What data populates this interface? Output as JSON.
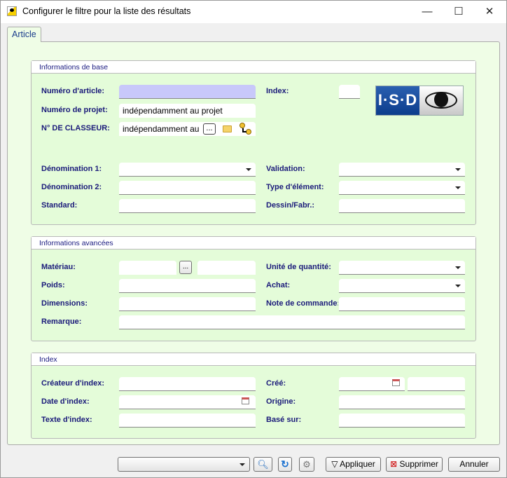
{
  "window": {
    "title": "Configurer le filtre pour la liste des résultats",
    "minimize": "—",
    "maximize": "☐",
    "close": "✕"
  },
  "tab": "Article",
  "groups": {
    "base": {
      "title": "Informations de base",
      "article_label": "Numéro d'article:",
      "project_label": "Numéro de projet:",
      "project_value": "indépendamment au projet",
      "folder_label": "N° DE CLASSEUR:",
      "folder_value": "indépendamment au",
      "browse": "...",
      "index_label": "Index:",
      "logo": "I·S·D",
      "den1_label": "Dénomination 1:",
      "den2_label": "Dénomination 2:",
      "standard_label": "Standard:",
      "validation_label": "Validation:",
      "type_label": "Type d'élément:",
      "drawing_label": "Dessin/Fabr.:"
    },
    "advanced": {
      "title": "Informations avancées",
      "material_label": "Matériau:",
      "browse": "...",
      "weight_label": "Poids:",
      "dims_label": "Dimensions:",
      "remark_label": "Remarque:",
      "unit_label": "Unité de quantité:",
      "purchase_label": "Achat:",
      "order_note_label": "Note de commande:"
    },
    "index": {
      "title": "Index",
      "creator_label": "Créateur d'index:",
      "date_label": "Date d'index:",
      "text_label": "Texte d'index:",
      "created_label": "Créé:",
      "origin_label": "Origine:",
      "based_label": "Basé sur:"
    }
  },
  "footer": {
    "apply": "Appliquer",
    "delete": "Supprimer",
    "cancel": "Annuler"
  }
}
